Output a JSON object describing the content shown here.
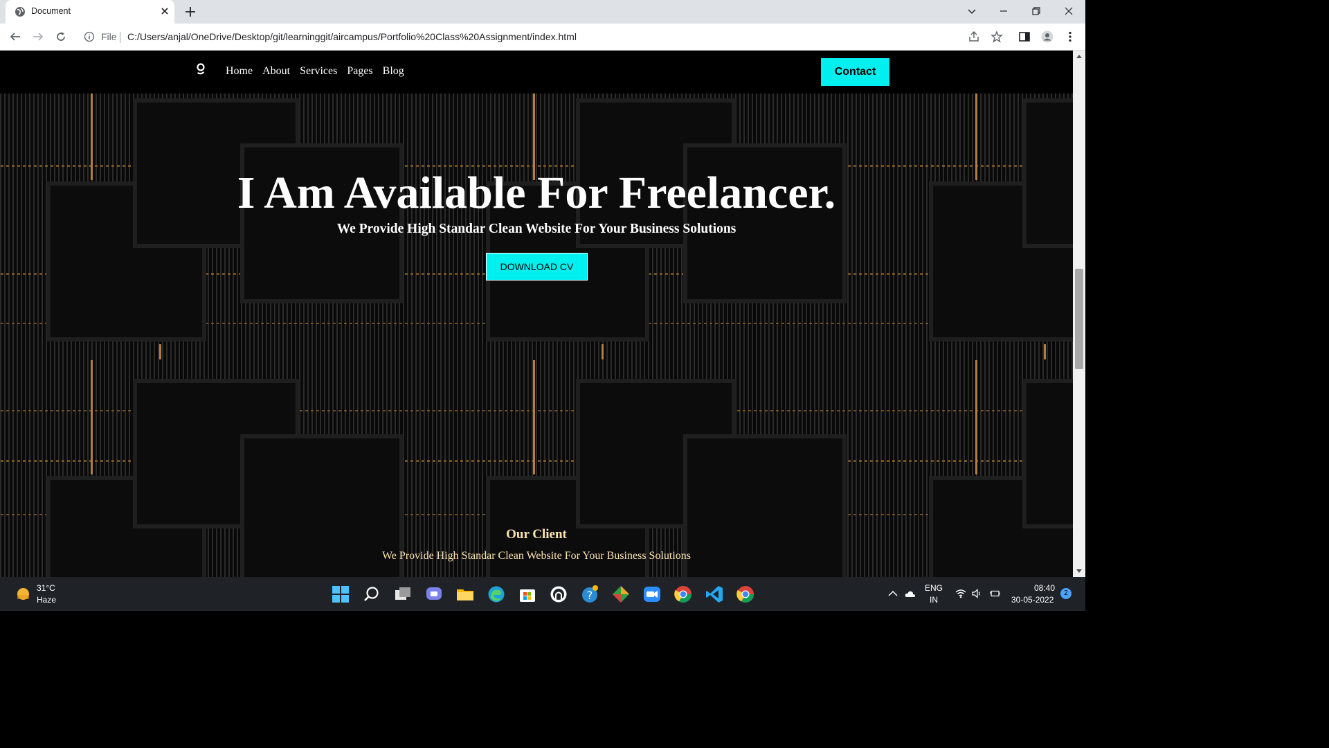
{
  "browser": {
    "tab_title": "Document",
    "omnibox_scheme": "File",
    "url": "C:/Users/anjal/OneDrive/Desktop/git/learninggit/aircampus/Portfolio%20Class%20Assignment/index.html"
  },
  "site": {
    "nav": {
      "logo": "g",
      "links": [
        "Home",
        "About",
        "Services",
        "Pages",
        "Blog"
      ],
      "contact_label": "Contact"
    },
    "hero": {
      "title": "I Am Available For Freelancer.",
      "subtitle": "We Provide High Standar Clean Website For Your Business Solutions",
      "cta_label": "DOWNLOAD CV"
    },
    "clients": {
      "title": "Our Client",
      "subtitle": "We Provide High Standar Clean Website For Your Business Solutions"
    },
    "colors": {
      "accent": "#00f0f0",
      "gold": "#e8a24a",
      "client_text": "#fbe3b0"
    }
  },
  "taskbar": {
    "weather_temp": "31°C",
    "weather_desc": "Haze",
    "lang_top": "ENG",
    "lang_bottom": "IN",
    "time": "08:40",
    "date": "30-05-2022",
    "notifications": "2",
    "apps": [
      "windows-start-icon",
      "search-icon",
      "task-view-icon",
      "teams-chat-icon",
      "file-explorer-icon",
      "edge-icon",
      "microsoft-store-icon",
      "github-desktop-icon",
      "help-icon",
      "git-icon",
      "zoom-icon",
      "chrome-icon",
      "vscode-icon",
      "chrome-active-icon"
    ]
  }
}
